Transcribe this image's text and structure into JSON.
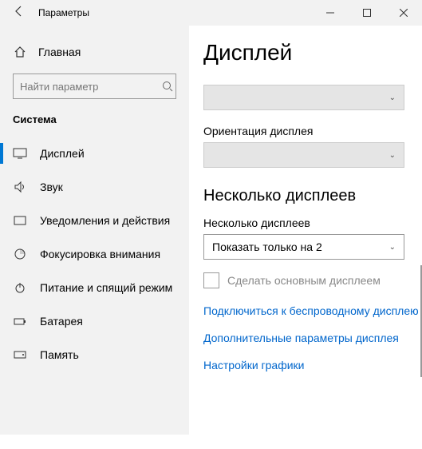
{
  "titlebar": {
    "title": "Параметры"
  },
  "sidebar": {
    "home": "Главная",
    "search_placeholder": "Найти параметр",
    "category": "Система",
    "items": [
      {
        "label": "Дисплей"
      },
      {
        "label": "Звук"
      },
      {
        "label": "Уведомления и действия"
      },
      {
        "label": "Фокусировка внимания"
      },
      {
        "label": "Питание и спящий режим"
      },
      {
        "label": "Батарея"
      },
      {
        "label": "Память"
      }
    ]
  },
  "main": {
    "heading": "Дисплей",
    "orientation_label": "Ориентация дисплея",
    "multi_heading": "Несколько дисплеев",
    "multi_label": "Несколько дисплеев",
    "multi_select_value": "Показать только на 2",
    "checkbox_label": "Сделать основным дисплеем",
    "links": [
      "Подключиться к беспроводному дисплею",
      "Дополнительные параметры дисплея",
      "Настройки графики"
    ]
  }
}
